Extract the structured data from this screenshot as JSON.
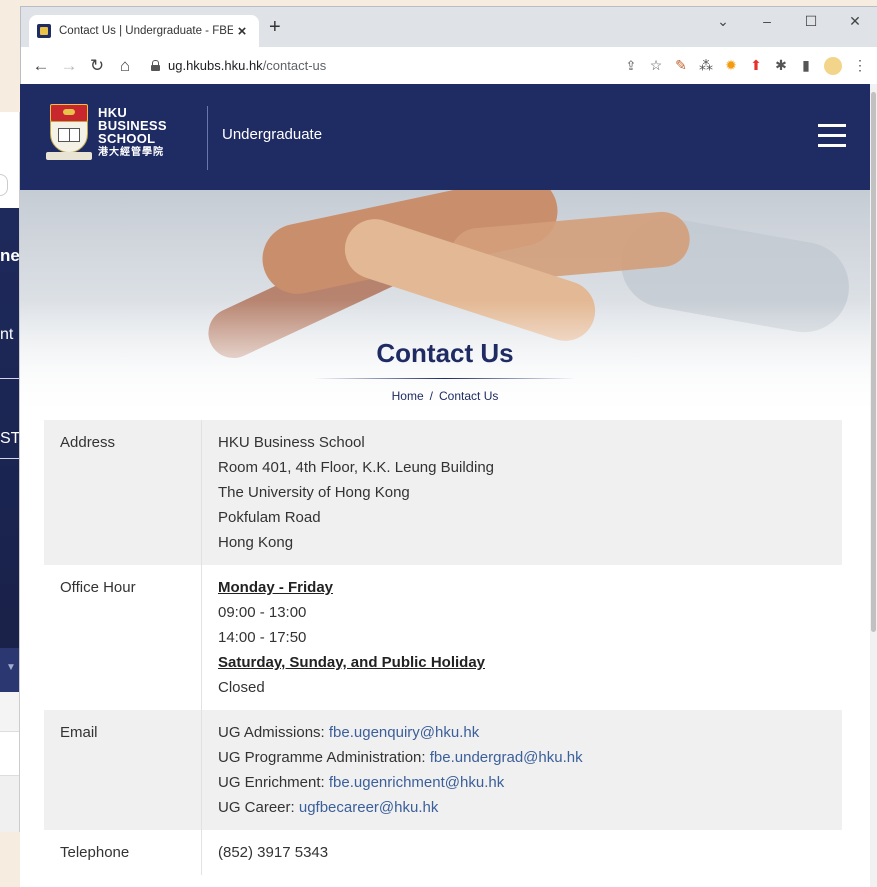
{
  "background_window": {
    "items": [
      "ne",
      "nt",
      "ST"
    ]
  },
  "browser": {
    "tab_title": "Contact Us | Undergraduate - FBE",
    "tab_close": "×",
    "new_tab": "+",
    "window_controls": {
      "dropdown": "⌄",
      "minimize": "–",
      "maximize": "☐",
      "close": "✕"
    },
    "url_domain": "ug.hkubs.hku.hk",
    "url_path": "/contact-us"
  },
  "site": {
    "logo_lines": [
      "HKU",
      "BUSINESS",
      "SCHOOL"
    ],
    "logo_zh": "港大經管學院",
    "subtitle": "Undergraduate"
  },
  "hero": {
    "title": "Contact Us",
    "breadcrumb_home": "Home",
    "breadcrumb_sep": "/",
    "breadcrumb_current": "Contact Us"
  },
  "contact": {
    "address_label": "Address",
    "address_lines": [
      "HKU Business School",
      "Room 401, 4th Floor, K.K. Leung Building",
      "The University of Hong Kong",
      "Pokfulam Road",
      "Hong Kong"
    ],
    "office_label": "Office Hour",
    "weekday_heading": "Monday - Friday",
    "weekday_hours": [
      "09:00 - 13:00",
      "14:00 - 17:50"
    ],
    "weekend_heading": "Saturday, Sunday, and Public Holiday",
    "weekend_status": "Closed",
    "email_label": "Email",
    "emails": [
      {
        "label": "UG Admissions: ",
        "address": "fbe.ugenquiry@hku.hk"
      },
      {
        "label": "UG Programme Administration: ",
        "address": "fbe.undergrad@hku.hk"
      },
      {
        "label": "UG Enrichment: ",
        "address": "fbe.ugenrichment@hku.hk"
      },
      {
        "label": "UG Career: ",
        "address": "ugfbecareer@hku.hk"
      }
    ],
    "telephone_label": "Telephone",
    "telephone": "(852) 3917 5343"
  },
  "colors": {
    "brand_navy": "#1f2b63",
    "link": "#3b5f9a",
    "row_shade": "#f0f0f0"
  }
}
